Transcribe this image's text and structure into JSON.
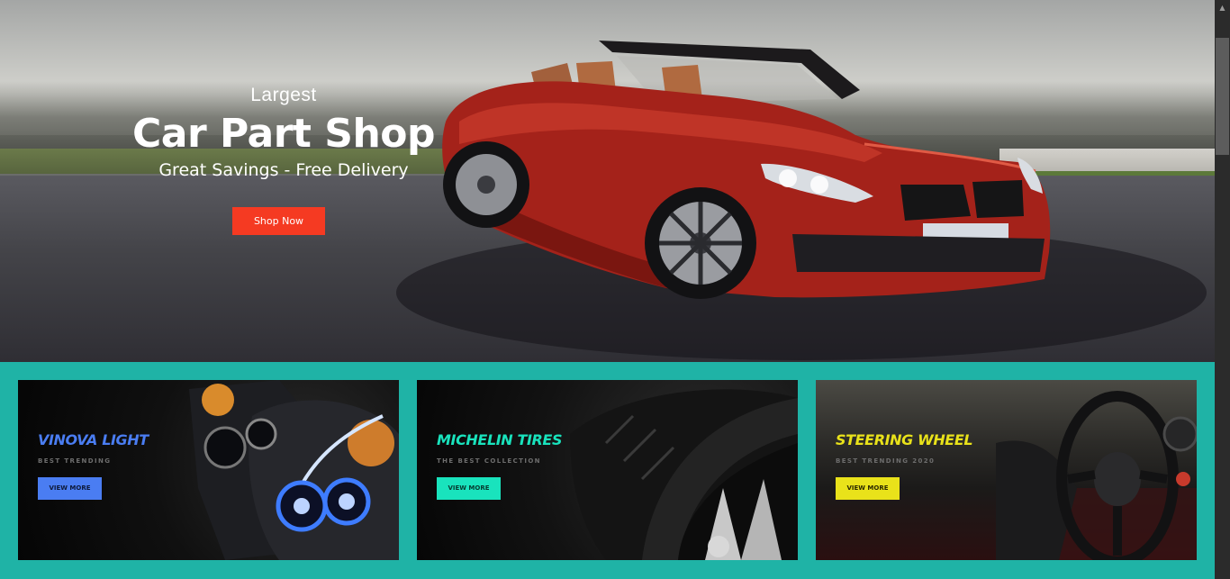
{
  "hero": {
    "eyebrow": "Largest",
    "title": "Car Part Shop",
    "subtitle": "Great Savings - Free Delivery",
    "cta_label": "Shop Now",
    "cta_color": "#f53a22"
  },
  "banners": [
    {
      "title": "VINOVA LIGHT",
      "subtitle": "BEST TRENDING",
      "button_label": "VIEW MORE",
      "accent": "#4a7df2",
      "image": "headlight-image"
    },
    {
      "title": "MICHELIN TIRES",
      "subtitle": "THE BEST COLLECTION",
      "button_label": "VIEW MORE",
      "accent": "#19e3bd",
      "image": "tire-image"
    },
    {
      "title": "STEERING WHEEL",
      "subtitle": "BEST TRENDING 2020",
      "button_label": "VIEW MORE",
      "accent": "#e9e21a",
      "image": "steering-wheel-image"
    }
  ],
  "section_background": "#1fb3a6",
  "icons": {
    "scroll_up": "scroll-up-arrow-icon"
  }
}
